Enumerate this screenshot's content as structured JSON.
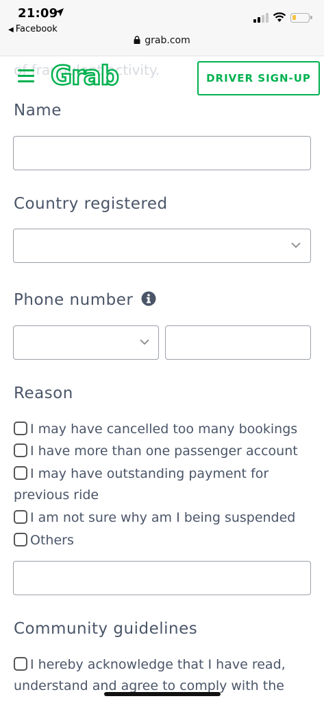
{
  "status_bar": {
    "time": "21:09",
    "back_app": "Facebook",
    "battery_color": "#f5c242"
  },
  "browser": {
    "url": "grab.com"
  },
  "header": {
    "ghost_text": "of fraudulent activity.",
    "logo_text": "Grab",
    "menu_icon": "hamburger-icon",
    "driver_signup_label": "DRIVER SIGN-UP",
    "brand_color": "#00b14f"
  },
  "form": {
    "name_label": "Name",
    "name_value": "",
    "country_label": "Country registered",
    "country_value": "",
    "phone_label": "Phone number",
    "phone_code_value": "",
    "phone_number_value": "",
    "reason_label": "Reason",
    "reasons": [
      "I may have cancelled too many bookings",
      "I have more than one passenger account",
      "I may have outstanding payment for",
      "I am not sure why am I being suspended",
      "Others"
    ],
    "reason_wrap": "previous ride",
    "other_value": "",
    "guidelines_label": "Community guidelines",
    "ack_line1": "I hereby acknowledge that I have read,",
    "ack_line2": "understand and agree to comply with the"
  }
}
